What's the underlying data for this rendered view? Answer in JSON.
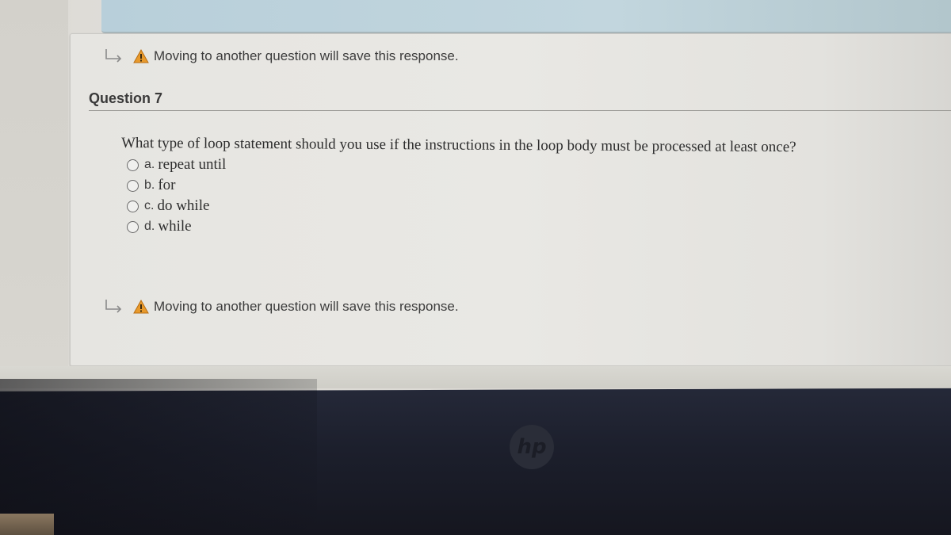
{
  "notices": {
    "top": "Moving to another question will save this response.",
    "bottom": "Moving to another question will save this response."
  },
  "question": {
    "heading": "Question 7",
    "prompt": "What type of loop statement should you use if the instructions in the loop body must be processed at least once?",
    "options": [
      {
        "letter": "a.",
        "text": "repeat until",
        "selected": false
      },
      {
        "letter": "b.",
        "text": "for",
        "selected": false
      },
      {
        "letter": "c.",
        "text": "do while",
        "selected": false
      },
      {
        "letter": "d.",
        "text": "while",
        "selected": false
      }
    ]
  },
  "device": {
    "logo": "hp"
  },
  "colors": {
    "warning": "#e89a2c",
    "bezel": "#1c1f2c"
  }
}
